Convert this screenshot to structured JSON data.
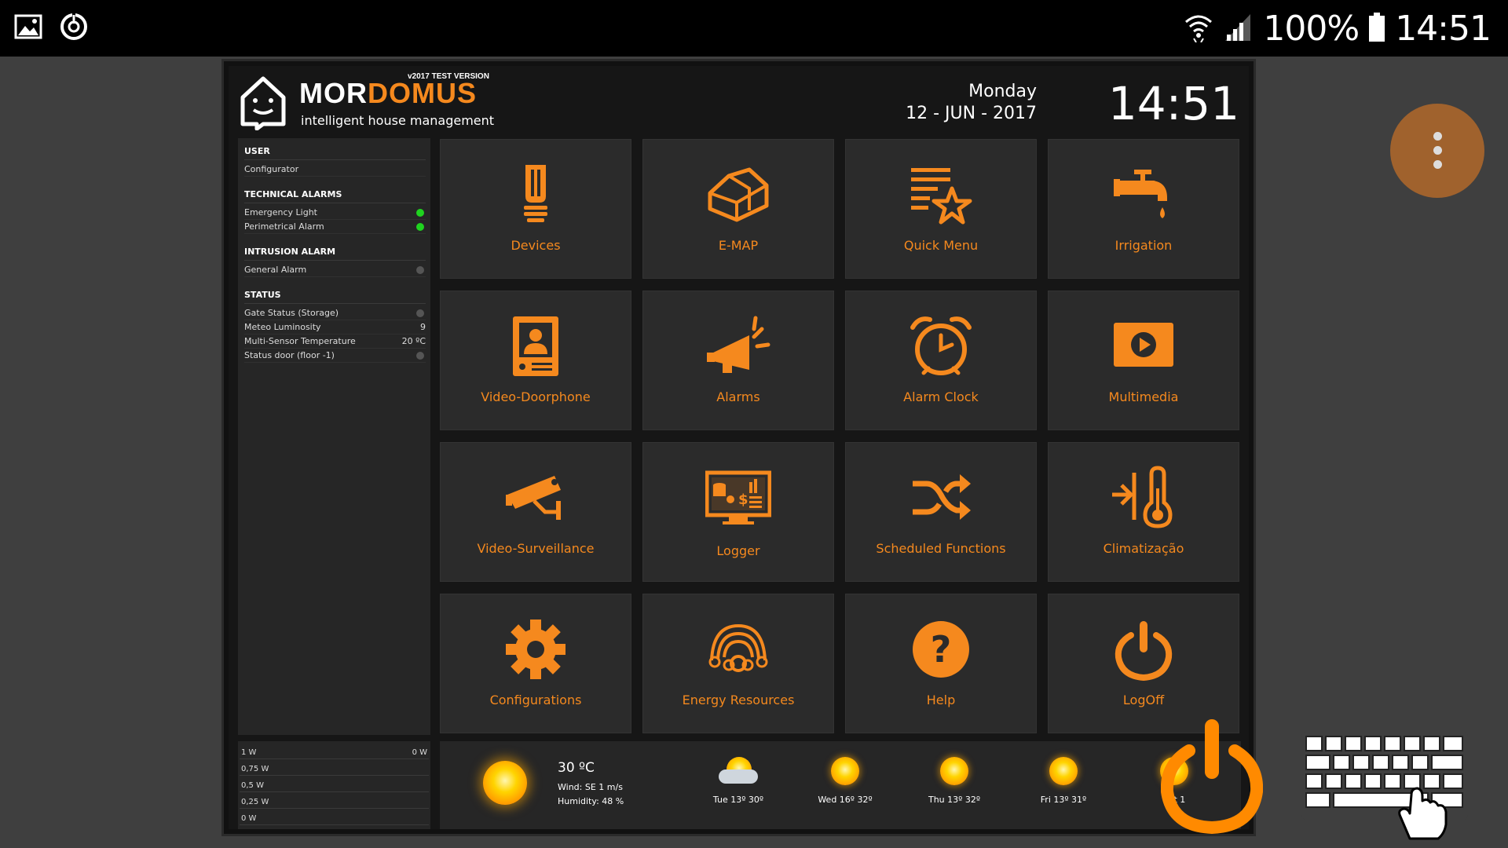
{
  "statusbar": {
    "battery": "100%",
    "time": "14:51"
  },
  "header": {
    "version": "v2017 TEST VERSION",
    "logo_mor": "MOR",
    "logo_domus": "DOMUS",
    "tagline": "intelligent house management",
    "day": "Monday",
    "date": "12 - JUN - 2017",
    "clock": "14:51"
  },
  "leftpanel": {
    "user": {
      "title": "USER",
      "name": "Configurator"
    },
    "technical": {
      "title": "TECHNICAL ALARMS",
      "items": [
        {
          "label": "Emergency Light",
          "status": "green"
        },
        {
          "label": "Perimetrical Alarm",
          "status": "green"
        }
      ]
    },
    "intrusion": {
      "title": "INTRUSION ALARM",
      "items": [
        {
          "label": "General Alarm",
          "status": "grey"
        }
      ]
    },
    "status": {
      "title": "STATUS",
      "items": [
        {
          "label": "Gate Status (Storage)",
          "value": ""
        },
        {
          "label": "Meteo Luminosity",
          "value": "9"
        },
        {
          "label": "Multi-Sensor Temperature",
          "value": "20 ºC"
        },
        {
          "label": "Status door (floor -1)",
          "value": ""
        }
      ]
    }
  },
  "power": {
    "current": "0 W",
    "scale": [
      "1 W",
      "0,75 W",
      "0,5 W",
      "0,25 W",
      "0 W"
    ]
  },
  "tiles": [
    {
      "label": "Devices",
      "icon": "lamp-icon"
    },
    {
      "label": "E-MAP",
      "icon": "house-map-icon"
    },
    {
      "label": "Quick Menu",
      "icon": "quick-menu-star-icon"
    },
    {
      "label": "Irrigation",
      "icon": "faucet-icon"
    },
    {
      "label": "Video-Doorphone",
      "icon": "doorphone-icon"
    },
    {
      "label": "Alarms",
      "icon": "megaphone-icon"
    },
    {
      "label": "Alarm Clock",
      "icon": "alarm-clock-icon"
    },
    {
      "label": "Multimedia",
      "icon": "play-icon"
    },
    {
      "label": "Video-Surveillance",
      "icon": "cctv-camera-icon"
    },
    {
      "label": "Logger",
      "icon": "logger-monitor-icon"
    },
    {
      "label": "Scheduled Functions",
      "icon": "shuffle-icon"
    },
    {
      "label": "Climatização",
      "icon": "thermometer-icon"
    },
    {
      "label": "Configurations",
      "icon": "gear-icon"
    },
    {
      "label": "Energy Resources",
      "icon": "energy-icon"
    },
    {
      "label": "Help",
      "icon": "help-icon"
    },
    {
      "label": "LogOff",
      "icon": "power-icon"
    }
  ],
  "weather": {
    "temp": "30 ºC",
    "wind": "Wind: SE 1 m/s",
    "humidity": "Humidity: 48 %",
    "forecast": [
      {
        "label": "Tue 13º 30º",
        "icon": "sun-cloud-icon"
      },
      {
        "label": "Wed 16º 32º",
        "icon": "sun-icon"
      },
      {
        "label": "Thu 13º 32º",
        "icon": "sun-icon"
      },
      {
        "label": "Fri 13º 31º",
        "icon": "sun-icon"
      },
      {
        "label": "Sat 1",
        "icon": "sun-icon"
      }
    ]
  },
  "colors": {
    "accent": "#f5891e",
    "tile_bg": "#2b2b2b"
  }
}
